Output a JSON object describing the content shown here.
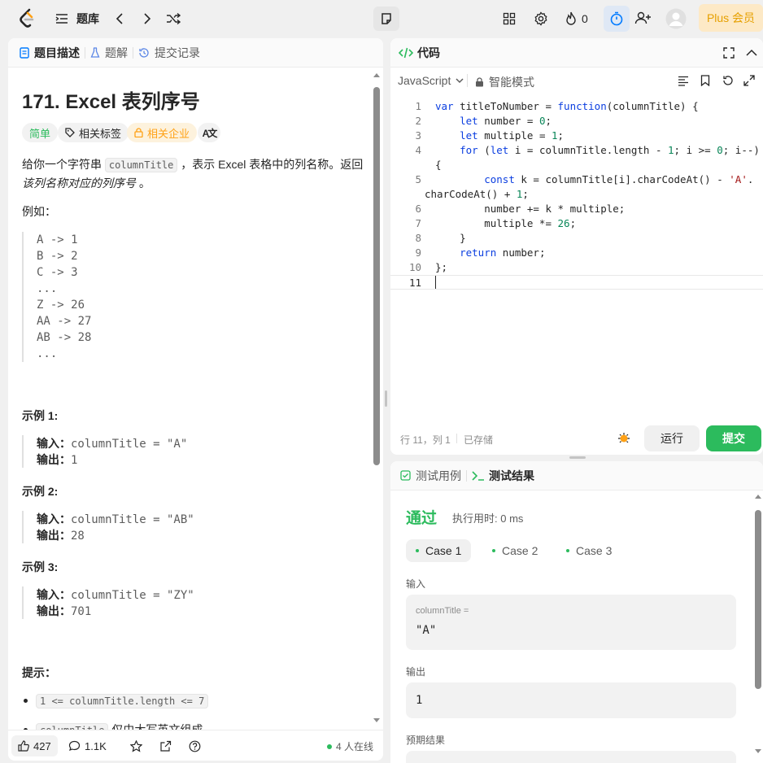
{
  "topbar": {
    "problem_bank": "题库",
    "fire_count": "0",
    "plus_label": "Plus 会员",
    "icons": [
      "logo-icon",
      "list-icon",
      "chevron-left-icon",
      "chevron-right-icon",
      "shuffle-icon",
      "note-icon",
      "grid-icon",
      "gear-icon",
      "fire-icon",
      "timer-icon",
      "add-user-icon",
      "avatar"
    ]
  },
  "left": {
    "tabs": {
      "description": "题目描述",
      "solution": "题解",
      "submissions": "提交记录"
    },
    "title": "171. Excel 表列序号",
    "chips": {
      "difficulty": "简单",
      "tags": "相关标签",
      "companies": "相关企业",
      "translate": "A文"
    },
    "intro_1": "给你一个字符串 ",
    "intro_code": "columnTitle",
    "intro_2": " ，表示 Excel 表格中的列名称。返回",
    "intro_3": "该列名称对应的列序号",
    "intro_4": " 。",
    "example_lead": "例如：",
    "mapping": [
      "A -> 1",
      "B -> 2",
      "C -> 3",
      "...",
      "Z -> 26",
      "AA -> 27",
      "AB -> 28",
      "..."
    ],
    "examples": [
      {
        "heading": "示例 1:",
        "input_label": "输入：",
        "input": "columnTitle = \"A\"",
        "output_label": "输出：",
        "output": "1"
      },
      {
        "heading": "示例 2:",
        "input_label": "输入：",
        "input": "columnTitle = \"AB\"",
        "output_label": "输出：",
        "output": "28"
      },
      {
        "heading": "示例 3:",
        "input_label": "输入：",
        "input": "columnTitle = \"ZY\"",
        "output_label": "输出：",
        "output": "701"
      }
    ],
    "hints_heading": "提示：",
    "hints": [
      {
        "code": "1 <= columnTitle.length <= 7",
        "text": ""
      },
      {
        "code": "columnTitle",
        "text": " 仅由大写英文组成"
      }
    ],
    "bottom": {
      "likes": "427",
      "comments": "1.1K",
      "online": "4 人在线"
    }
  },
  "editor": {
    "tab": "代码",
    "language": "JavaScript",
    "mode": "智能模式",
    "line_numbers": [
      "1",
      "2",
      "3",
      "4",
      "",
      "5",
      "",
      "6",
      "7",
      "8",
      "9",
      "10",
      "11"
    ],
    "status_pos": "行 11，列 1",
    "status_saved": "已存储",
    "run": "运行",
    "submit": "提交"
  },
  "results": {
    "tab_cases": "测试用例",
    "tab_results": "测试结果",
    "verdict": "通过",
    "runtime": "执行用时: 0 ms",
    "cases": [
      "Case 1",
      "Case 2",
      "Case 3"
    ],
    "input_label": "输入",
    "var_name": "columnTitle =",
    "var_value": "\"A\"",
    "output_label": "输出",
    "output_value": "1",
    "expected_label": "预期结果"
  },
  "colors": {
    "accent_green": "#2cbb5d",
    "brand_orange": "#ffa116",
    "link_blue": "#007aff"
  }
}
